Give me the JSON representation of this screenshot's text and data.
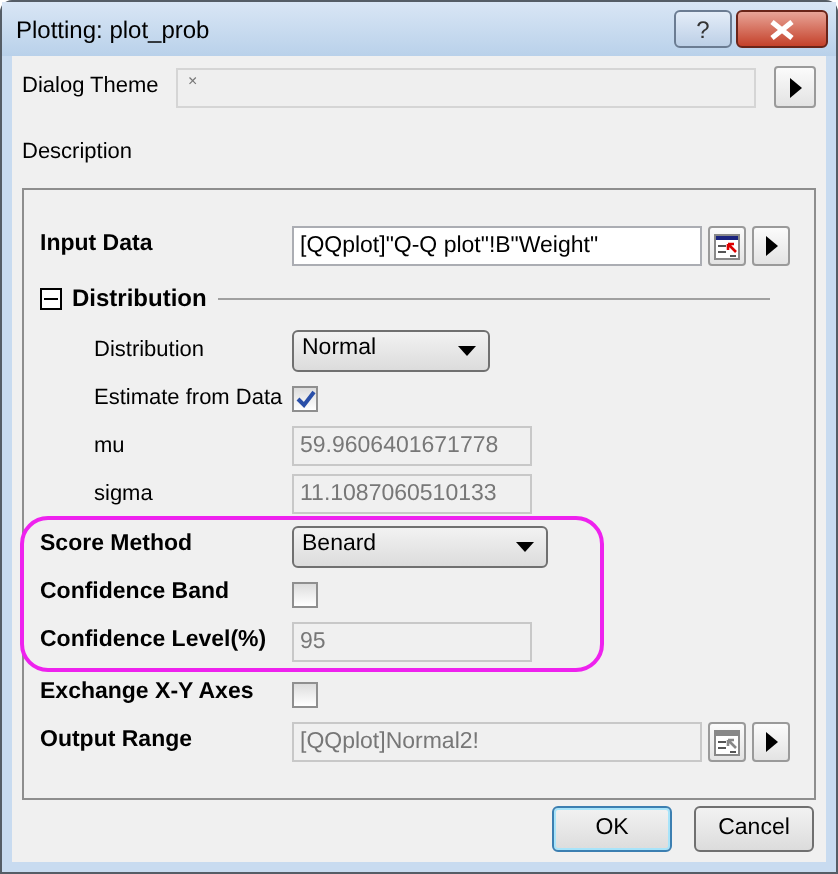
{
  "window": {
    "title": "Plotting: plot_prob",
    "help_button": "?"
  },
  "dialog_theme": {
    "label": "Dialog Theme",
    "value": "×"
  },
  "description": {
    "label": "Description"
  },
  "rows": [
    {
      "kind": "range",
      "label": "Input Data",
      "value": "[QQplot]\"Q-Q plot\"!B\"Weight\"",
      "disabled": false,
      "highlighted": false
    },
    {
      "kind": "section",
      "label": "Distribution",
      "expanded": true,
      "highlighted": false,
      "children": [
        {
          "kind": "select",
          "label": "Distribution",
          "value": "Normal"
        },
        {
          "kind": "checkbox",
          "label": "Estimate from Data",
          "checked": true
        },
        {
          "kind": "text",
          "label": "mu",
          "value": "59.9606401671778",
          "disabled": true
        },
        {
          "kind": "text",
          "label": "sigma",
          "value": "11.1087060510133",
          "disabled": true
        }
      ]
    },
    {
      "kind": "select",
      "label": "Score Method",
      "value": "Benard",
      "highlighted": true
    },
    {
      "kind": "checkbox",
      "label": "Confidence Band",
      "checked": false,
      "highlighted": true
    },
    {
      "kind": "text",
      "label": "Confidence Level(%)",
      "value": "95",
      "disabled": true,
      "highlighted": true
    },
    {
      "kind": "checkbox",
      "label": "Exchange X-Y Axes",
      "checked": false,
      "highlighted": false
    },
    {
      "kind": "range",
      "label": "Output Range",
      "value": "[QQplot]Normal2!",
      "disabled": true,
      "highlighted": false
    }
  ],
  "buttons": [
    {
      "label": "OK",
      "default": true
    },
    {
      "label": "Cancel",
      "default": false
    }
  ]
}
